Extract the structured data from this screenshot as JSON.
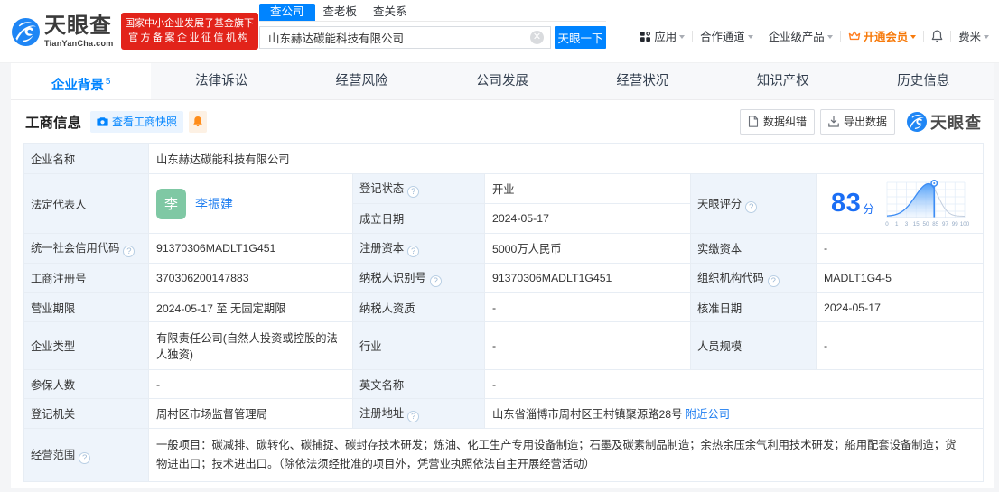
{
  "icons": {
    "clear": "✕",
    "help": "?"
  },
  "header": {
    "logo": {
      "title": "天眼查",
      "domain": "TianYanCha.com"
    },
    "badge": {
      "line1": "国家中小企业发展子基金旗下",
      "line2": "官方备案企业征信机构"
    },
    "search": {
      "tabs": [
        {
          "label": "查公司",
          "active": true
        },
        {
          "label": "查老板",
          "active": false
        },
        {
          "label": "查关系",
          "active": false
        }
      ],
      "input_value": "山东赫达碳能科技有限公司",
      "clear_icon": "×",
      "button_label": "天眼一下"
    },
    "menu": {
      "apps": "应用",
      "cooperation": "合作通道",
      "enterprise_products": "企业级产品",
      "vip": "开通会员",
      "user": "费米"
    }
  },
  "nav_tabs": [
    {
      "label": "企业背景",
      "count": "5",
      "active": true
    },
    {
      "label": "法律诉讼",
      "active": false
    },
    {
      "label": "经营风险",
      "active": false
    },
    {
      "label": "公司发展",
      "active": false
    },
    {
      "label": "经营状况",
      "active": false
    },
    {
      "label": "知识产权",
      "active": false
    },
    {
      "label": "历史信息",
      "active": false
    }
  ],
  "section": {
    "title": "工商信息",
    "snapshot_button": "查看工商快照",
    "correction_button": "数据纠错",
    "export_button": "导出数据",
    "watermark": "天眼查"
  },
  "score": {
    "value": "83",
    "unit": "分",
    "chart_data": {
      "type": "area",
      "title": "天眼评分分布曲线",
      "x_ticks": [
        "0",
        "1",
        "3",
        "15",
        "50",
        "85",
        "97",
        "99",
        "100"
      ],
      "marker_value": 83,
      "marker_tick": "85",
      "curve": "normal-distribution",
      "fill": "blue gradient left of marker, gray line right of marker"
    }
  },
  "fields": {
    "company_name": {
      "label": "企业名称",
      "value": "山东赫达碳能科技有限公司"
    },
    "legal_rep": {
      "label": "法定代表人",
      "avatar": "李",
      "name": "李振建"
    },
    "reg_status": {
      "label": "登记状态",
      "value": "开业"
    },
    "establish_date": {
      "label": "成立日期",
      "value": "2024-05-17"
    },
    "score_label": {
      "label": "天眼评分"
    },
    "credit_code": {
      "label": "统一社会信用代码",
      "value": "91370306MADLT1G451"
    },
    "reg_capital": {
      "label": "注册资本",
      "value": "5000万人民币"
    },
    "paid_capital": {
      "label": "实缴资本",
      "value": "-"
    },
    "reg_number": {
      "label": "工商注册号",
      "value": "370306200147883"
    },
    "taxpayer_id": {
      "label": "纳税人识别号",
      "value": "91370306MADLT1G451"
    },
    "org_code": {
      "label": "组织机构代码",
      "value": "MADLT1G4-5"
    },
    "business_term": {
      "label": "营业期限",
      "value": "2024-05-17 至 无固定期限"
    },
    "taxpayer_quality": {
      "label": "纳税人资质",
      "value": "-"
    },
    "approval_date": {
      "label": "核准日期",
      "value": "2024-05-17"
    },
    "company_type": {
      "label": "企业类型",
      "value": "有限责任公司(自然人投资或控股的法人独资)"
    },
    "industry": {
      "label": "行业",
      "value": "-"
    },
    "staff_size": {
      "label": "人员规模",
      "value": "-"
    },
    "insured_count": {
      "label": "参保人数",
      "value": "-"
    },
    "english_name": {
      "label": "英文名称",
      "value": "-"
    },
    "reg_authority": {
      "label": "登记机关",
      "value": "周村区市场监督管理局"
    },
    "reg_address": {
      "label": "注册地址",
      "value": "山东省淄博市周村区王村镇聚源路28号",
      "link": "附近公司"
    },
    "business_scope": {
      "label": "经营范围",
      "value": "一般项目：碳减排、碳转化、碳捕捉、碳封存技术研发；炼油、化工生产专用设备制造；石墨及碳素制品制造；余热余压余气利用技术研发；船用配套设备制造；货物进出口；技术进出口。（除依法须经批准的项目外，凭营业执照依法自主开展经营活动）"
    }
  }
}
